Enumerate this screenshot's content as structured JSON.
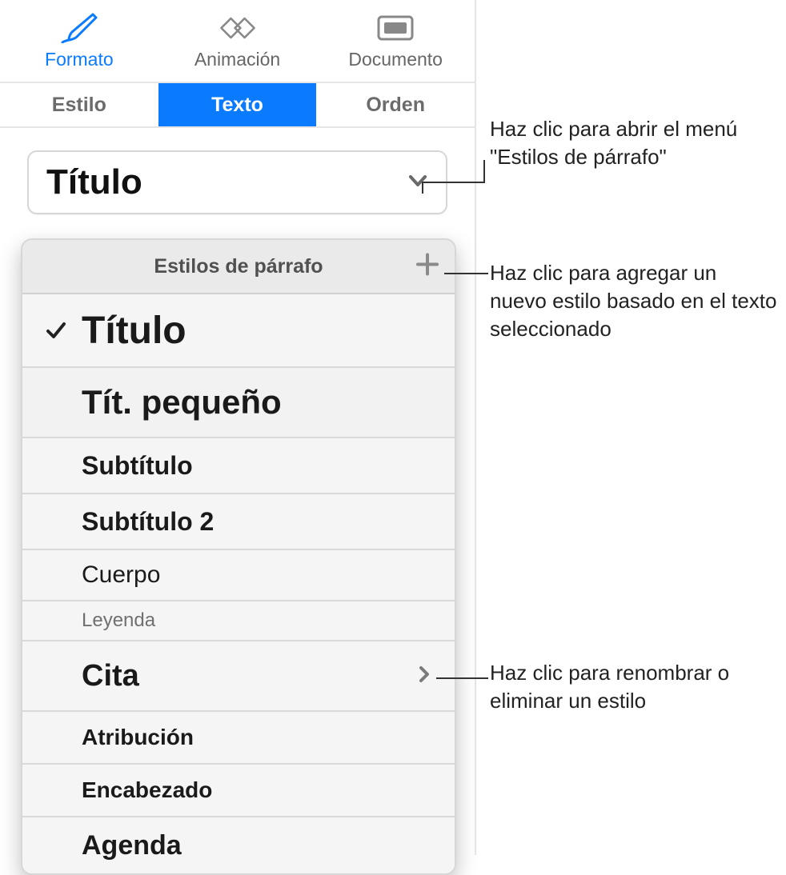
{
  "toolbar": {
    "tabs": [
      {
        "label": "Formato",
        "active": true
      },
      {
        "label": "Animación",
        "active": false
      },
      {
        "label": "Documento",
        "active": false
      }
    ]
  },
  "subtabs": [
    {
      "label": "Estilo",
      "active": false
    },
    {
      "label": "Texto",
      "active": true
    },
    {
      "label": "Orden",
      "active": false
    }
  ],
  "style_button": {
    "current_style": "Título"
  },
  "popover": {
    "title": "Estilos de párrafo",
    "items": [
      {
        "label": "Título",
        "selected": true,
        "has_submenu": false
      },
      {
        "label": "Tít. pequeño",
        "selected": false,
        "has_submenu": false
      },
      {
        "label": "Subtítulo",
        "selected": false,
        "has_submenu": false
      },
      {
        "label": "Subtítulo 2",
        "selected": false,
        "has_submenu": false
      },
      {
        "label": "Cuerpo",
        "selected": false,
        "has_submenu": false
      },
      {
        "label": "Leyenda",
        "selected": false,
        "has_submenu": false
      },
      {
        "label": "Cita",
        "selected": false,
        "has_submenu": true
      },
      {
        "label": "Atribución",
        "selected": false,
        "has_submenu": false
      },
      {
        "label": "Encabezado",
        "selected": false,
        "has_submenu": false
      },
      {
        "label": "Agenda",
        "selected": false,
        "has_submenu": false
      }
    ]
  },
  "callouts": {
    "open_menu": "Haz clic para abrir el menú \"Estilos de párrafo\"",
    "add_style": "Haz clic para agregar un nuevo estilo basado en el texto seleccionado",
    "rename_del": "Haz clic para renombrar o eliminar un estilo"
  }
}
